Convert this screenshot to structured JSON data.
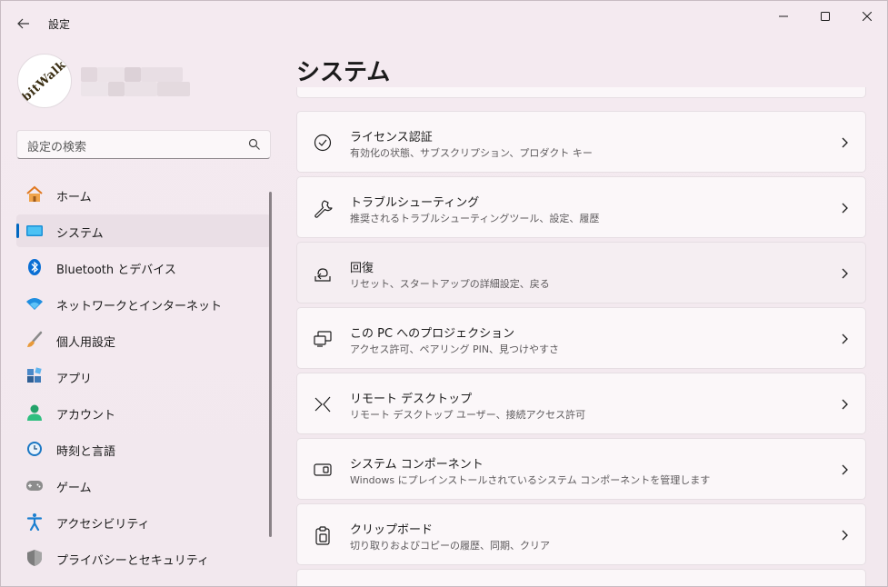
{
  "window": {
    "title": "設定",
    "back_icon": "back-arrow-icon",
    "controls": [
      "minimize-icon",
      "maximize-icon",
      "close-icon"
    ]
  },
  "profile": {
    "avatar_logo_text": "bitWalk"
  },
  "search": {
    "placeholder": "設定の検索",
    "icon": "search-icon"
  },
  "sidebar": {
    "items": [
      {
        "label": "ホーム",
        "icon": "home-icon"
      },
      {
        "label": "システム",
        "icon": "system-icon",
        "active": true
      },
      {
        "label": "Bluetooth とデバイス",
        "icon": "bluetooth-icon"
      },
      {
        "label": "ネットワークとインターネット",
        "icon": "wifi-icon"
      },
      {
        "label": "個人用設定",
        "icon": "brush-icon"
      },
      {
        "label": "アプリ",
        "icon": "apps-icon"
      },
      {
        "label": "アカウント",
        "icon": "account-icon"
      },
      {
        "label": "時刻と言語",
        "icon": "time-language-icon"
      },
      {
        "label": "ゲーム",
        "icon": "gaming-icon"
      },
      {
        "label": "アクセシビリティ",
        "icon": "accessibility-icon"
      },
      {
        "label": "プライバシーとセキュリティ",
        "icon": "shield-icon"
      }
    ]
  },
  "main": {
    "title": "システム",
    "cards": [
      {
        "title": "ライセンス認証",
        "subtitle": "有効化の状態、サブスクリプション、プロダクト キー",
        "icon": "activation-check-icon"
      },
      {
        "title": "トラブルシューティング",
        "subtitle": "推奨されるトラブルシューティングツール、設定、履歴",
        "icon": "wrench-icon"
      },
      {
        "title": "回復",
        "subtitle": "リセット、スタートアップの詳細設定、戻る",
        "icon": "recovery-icon"
      },
      {
        "title": "この PC へのプロジェクション",
        "subtitle": "アクセス許可、ペアリング PIN、見つけやすさ",
        "icon": "projection-icon"
      },
      {
        "title": "リモート デスクトップ",
        "subtitle": "リモート デスクトップ ユーザー、接続アクセス許可",
        "icon": "remote-desktop-icon"
      },
      {
        "title": "システム コンポーネント",
        "subtitle": "Windows にプレインストールされているシステム コンポーネントを管理します",
        "icon": "system-components-icon"
      },
      {
        "title": "クリップボード",
        "subtitle": "切り取りおよびコピーの履歴、同期、クリア",
        "icon": "clipboard-icon"
      }
    ]
  },
  "colors": {
    "accent": "#0067c0",
    "background": "#f3e9ef",
    "card": "#fbf7f9"
  }
}
